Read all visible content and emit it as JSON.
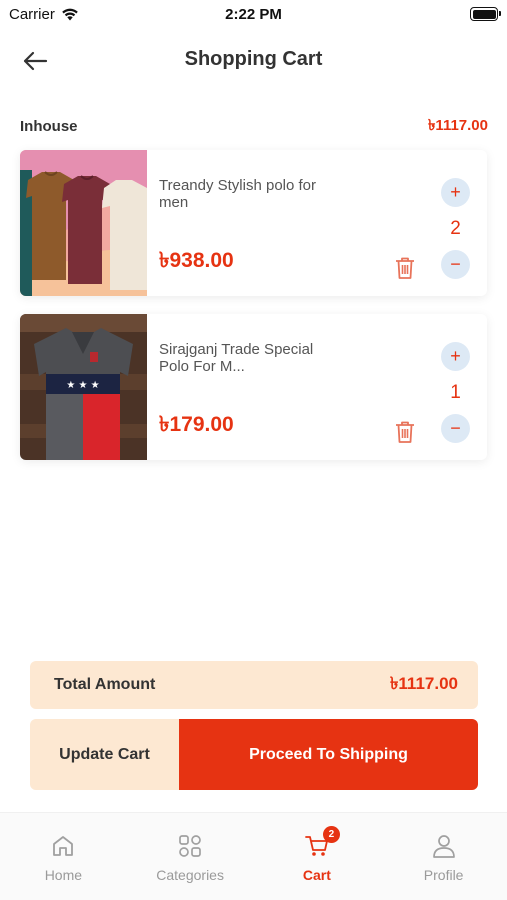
{
  "status_bar": {
    "carrier": "Carrier",
    "time": "2:22 PM"
  },
  "header": {
    "title": "Shopping Cart",
    "back_icon": "arrow-left-icon"
  },
  "seller": {
    "name": "Inhouse",
    "total": "৳1117.00"
  },
  "items": [
    {
      "name": "Treandy Stylish polo for men",
      "price": "৳938.00",
      "quantity": "2",
      "plus": "+",
      "minus": "−"
    },
    {
      "name": "Sirajganj Trade Special Polo For M...",
      "price": "৳179.00",
      "quantity": "1",
      "plus": "+",
      "minus": "−"
    }
  ],
  "summary": {
    "label": "Total Amount",
    "value": "৳1117.00"
  },
  "actions": {
    "update_label": "Update Cart",
    "ship_label": "Proceed To Shipping"
  },
  "tabs": [
    {
      "label": "Home",
      "icon": "home-icon"
    },
    {
      "label": "Categories",
      "icon": "grid-icon"
    },
    {
      "label": "Cart",
      "icon": "cart-icon",
      "badge": "2",
      "active": true
    },
    {
      "label": "Profile",
      "icon": "user-icon"
    }
  ],
  "colors": {
    "accent": "#e63312",
    "accent_soft": "#fde8d2",
    "stepper_bg": "#dde9f5"
  }
}
